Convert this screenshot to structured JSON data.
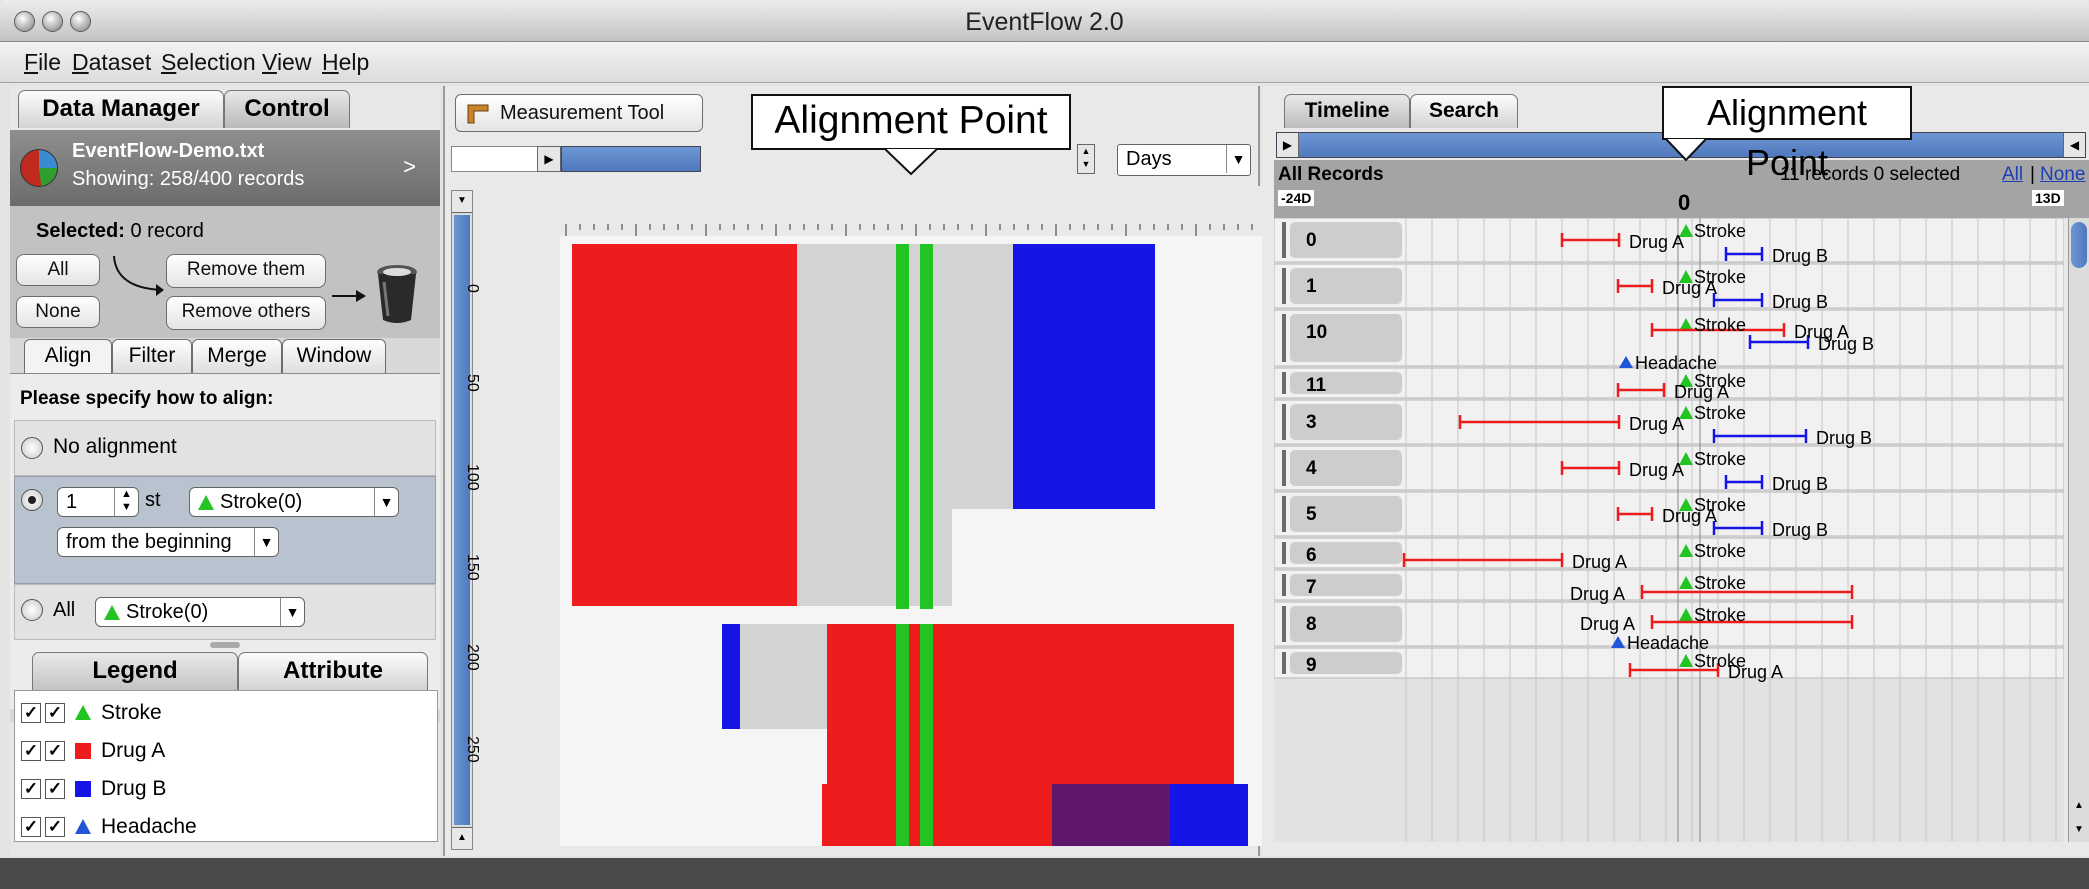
{
  "app": {
    "title": "EventFlow 2.0"
  },
  "menu": [
    {
      "label": "File",
      "u": "F",
      "rest": "ile"
    },
    {
      "label": "Dataset",
      "u": "D",
      "rest": "ataset"
    },
    {
      "label": "Selection",
      "u": "S",
      "rest": "election"
    },
    {
      "label": "View",
      "u": "V",
      "rest": "iew"
    },
    {
      "label": "Help",
      "u": "H",
      "rest": "elp"
    }
  ],
  "left": {
    "tabs": [
      "Data Manager",
      "Control"
    ],
    "dataset": {
      "name": "EventFlow-Demo.txt",
      "showing": "Showing: 258/400 records",
      "chevron": ">"
    },
    "selected": {
      "label": "Selected:",
      "value": "0 record"
    },
    "buttons": {
      "all": "All",
      "none": "None",
      "remove_them": "Remove them",
      "remove_others": "Remove others"
    },
    "subtabs": [
      "Align",
      "Filter",
      "Merge",
      "Window"
    ],
    "align": {
      "prompt": "Please specify how to align:",
      "no_alignment": "No alignment",
      "nth_value": "1",
      "nth_suffix": "st",
      "event": "Stroke(0)",
      "from": "from the beginning",
      "all_label": "All",
      "all_event": "Stroke(0)"
    },
    "legend_tabs": [
      "Legend",
      "Attribute"
    ],
    "legend": [
      {
        "label": "Stroke",
        "shape": "triangle",
        "color": "#22c322"
      },
      {
        "label": "Drug A",
        "shape": "square",
        "color": "#ee1c1c"
      },
      {
        "label": "Drug B",
        "shape": "square",
        "color": "#1515e6"
      },
      {
        "label": "Headache",
        "shape": "triangle",
        "color": "#2355d8"
      }
    ]
  },
  "middle": {
    "tool": "Measurement Tool",
    "unit": "Days",
    "zero_label": "0 0",
    "y_ticks": [
      "0",
      "50",
      "100",
      "150",
      "200",
      "250"
    ],
    "callout": "Alignment Point"
  },
  "right": {
    "tabs": [
      "Timeline",
      "Search"
    ],
    "header": {
      "title": "All Records",
      "selection": "11 records 0 selected",
      "all": "All",
      "sep": "|",
      "none": "None"
    },
    "axis": {
      "start": "-24D",
      "zero": "0",
      "end": "13D"
    },
    "callout": "Alignment Point",
    "records": [
      {
        "id": "0",
        "events": [
          {
            "label": "Stroke"
          },
          {
            "label": "Drug A"
          },
          {
            "label": "Drug B"
          }
        ]
      },
      {
        "id": "1",
        "events": [
          {
            "label": "Stroke"
          },
          {
            "label": "Drug A"
          },
          {
            "label": "Drug B"
          }
        ]
      },
      {
        "id": "10",
        "events": [
          {
            "label": "Stroke"
          },
          {
            "label": "Drug A"
          },
          {
            "label": "Drug B"
          },
          {
            "label": "Headache"
          }
        ]
      },
      {
        "id": "11",
        "events": [
          {
            "label": "Stroke"
          },
          {
            "label": "Drug A"
          }
        ]
      },
      {
        "id": "3",
        "events": [
          {
            "label": "Stroke"
          },
          {
            "label": "Drug A"
          },
          {
            "label": "Drug B"
          }
        ]
      },
      {
        "id": "4",
        "events": [
          {
            "label": "Stroke"
          },
          {
            "label": "Drug A"
          },
          {
            "label": "Drug B"
          }
        ]
      },
      {
        "id": "5",
        "events": [
          {
            "label": "Stroke"
          },
          {
            "label": "Drug A"
          },
          {
            "label": "Drug B"
          }
        ]
      },
      {
        "id": "6",
        "events": [
          {
            "label": "Stroke"
          },
          {
            "label": "Drug A"
          }
        ]
      },
      {
        "id": "7",
        "events": [
          {
            "label": "Stroke"
          },
          {
            "label": "Drug A"
          }
        ]
      },
      {
        "id": "8",
        "events": [
          {
            "label": "Stroke"
          },
          {
            "label": "Drug A"
          },
          {
            "label": "Headache"
          }
        ]
      },
      {
        "id": "9",
        "events": [
          {
            "label": "Stroke"
          },
          {
            "label": "Drug A"
          }
        ]
      }
    ]
  },
  "colors": {
    "stroke": "#22c322",
    "drugA": "#ee1c1c",
    "drugB": "#1515e6",
    "headache": "#2355d8",
    "gray": "#d3d3d3",
    "purple": "#5e176b"
  }
}
